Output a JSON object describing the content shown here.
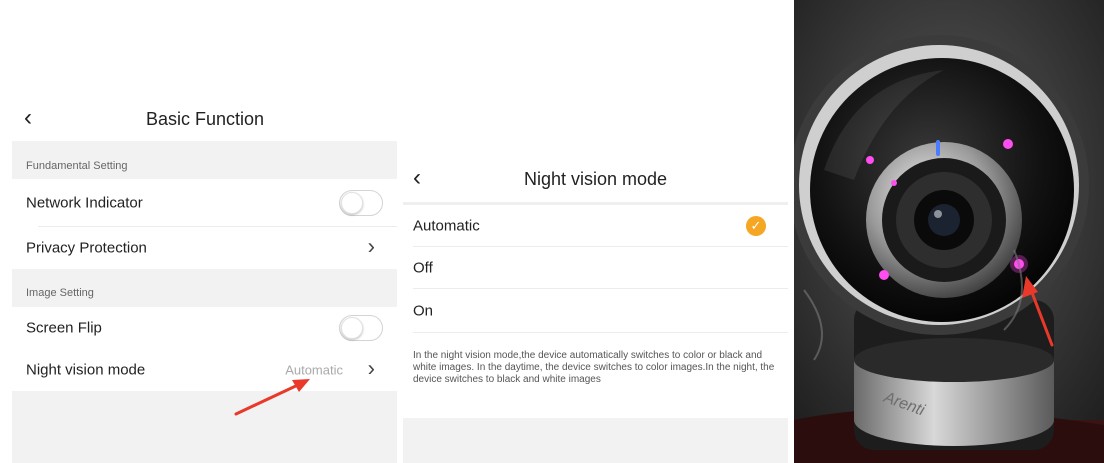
{
  "basic_function": {
    "title": "Basic Function",
    "sections": [
      {
        "header": "Fundamental Setting",
        "rows": [
          {
            "label": "Network Indicator",
            "control": "toggle",
            "on": false
          },
          {
            "label": "Privacy Protection",
            "control": "chevron"
          }
        ]
      },
      {
        "header": "Image Setting",
        "rows": [
          {
            "label": "Screen Flip",
            "control": "toggle",
            "on": false
          },
          {
            "label": "Night vision mode",
            "control": "chevron",
            "value": "Automatic"
          }
        ]
      }
    ]
  },
  "night_vision": {
    "title": "Night vision mode",
    "options": [
      {
        "label": "Automatic",
        "selected": true
      },
      {
        "label": "Off",
        "selected": false
      },
      {
        "label": "On",
        "selected": false
      }
    ],
    "description": "In the night vision mode,the device automatically switches to color or black and white images. In the daytime, the device switches to color images.In the night, the device switches to black and white images"
  },
  "photo": {
    "brand": "Arenti"
  },
  "colors": {
    "accent": "#f5a623",
    "arrow": "#e8392a",
    "section_bg": "#f2f2f2",
    "ir_led": "#ff4df0"
  },
  "icons": {
    "back": "chevron-left-icon",
    "forward": "chevron-right-icon",
    "selected": "checkmark-circle-icon"
  }
}
